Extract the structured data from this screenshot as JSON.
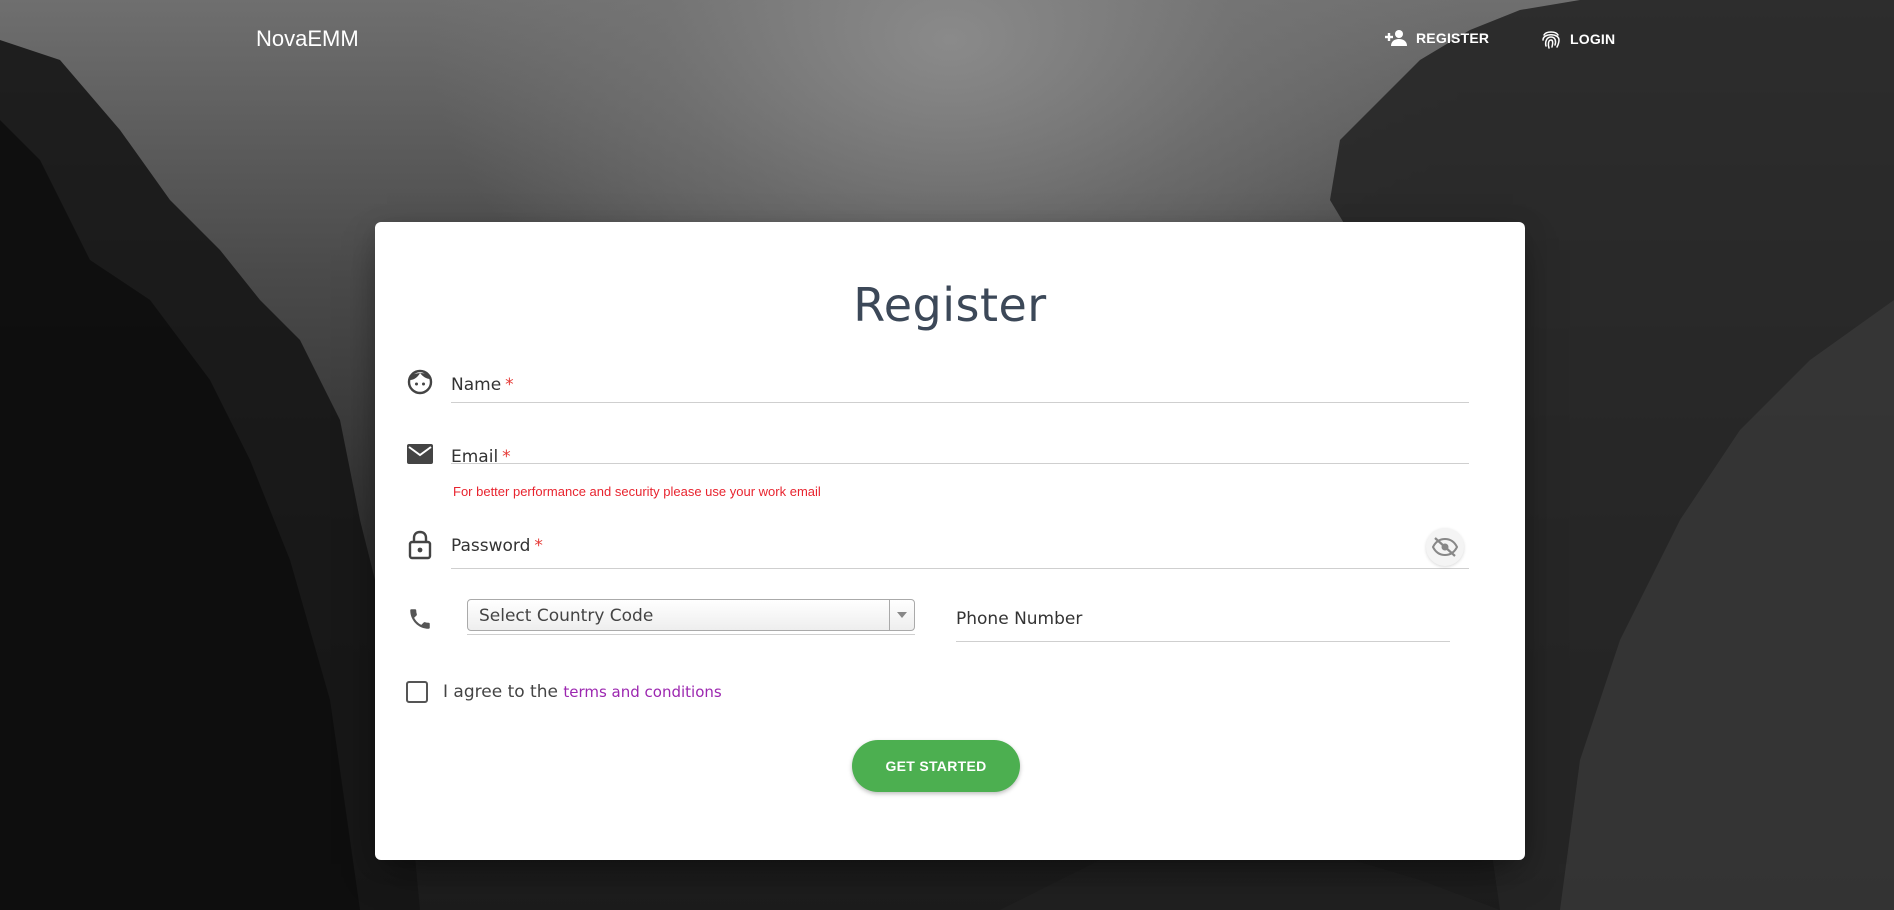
{
  "navbar": {
    "brand": "NovaEMM",
    "register_label": "REGISTER",
    "login_label": "LOGIN"
  },
  "form": {
    "title": "Register",
    "name_label": "Name",
    "email_label": "Email",
    "email_hint": "For better performance and security please use your work email",
    "password_label": "Password",
    "required_mark": "*",
    "country_code_placeholder": "Select Country Code",
    "phone_label": "Phone Number",
    "agree_text": "I agree to the",
    "terms_link": "terms and conditions",
    "submit_label": "GET STARTED"
  },
  "icons": {
    "name": "face-icon",
    "email": "mail-icon",
    "password": "lock-icon",
    "phone": "phone-icon",
    "visibility": "visibility-off-icon",
    "register": "person-add-icon",
    "login": "fingerprint-icon"
  },
  "colors": {
    "accent": "#4caf50",
    "required": "#e53935",
    "hint": "#e8242f",
    "link": "#9c27b0"
  }
}
